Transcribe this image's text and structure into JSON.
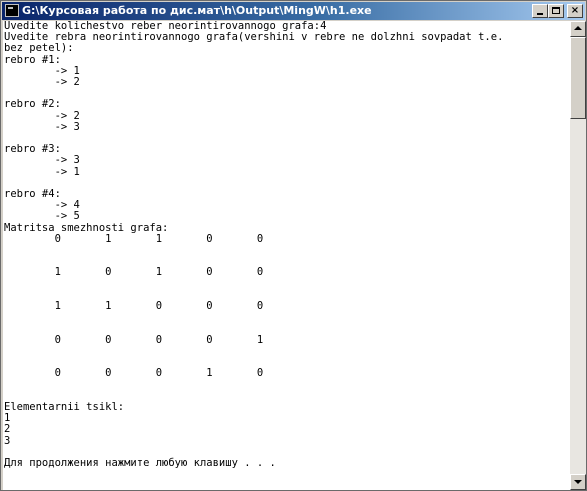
{
  "window": {
    "title": "G:\\Курсовая работа по дис.мат\\h\\Output\\MingW\\h1.exe",
    "minimize_label": "",
    "maximize_label": "",
    "close_label": "×"
  },
  "console": {
    "lines": [
      "Uvedite kolichestvo reber neorintirovannogo grafa:4",
      "Uvedite rebra neorintirovannogo grafa(vershini v rebre ne dolzhni sovpadat t.e.",
      "bez petel):",
      "rebro #1:",
      "        -> 1",
      "        -> 2",
      "",
      "rebro #2:",
      "        -> 2",
      "        -> 3",
      "",
      "rebro #3:",
      "        -> 3",
      "        -> 1",
      "",
      "rebro #4:",
      "        -> 4",
      "        -> 5",
      "Matritsa smezhnosti grafa:",
      "        0       1       1       0       0",
      "",
      "",
      "        1       0       1       0       0",
      "",
      "",
      "        1       1       0       0       0",
      "",
      "",
      "        0       0       0       0       1",
      "",
      "",
      "        0       0       0       1       0",
      "",
      "",
      "Elementarnii tsikl:",
      "1",
      "2",
      "3",
      "",
      "Для продолжения нажмите любую клавишу . . ."
    ]
  },
  "scrollbar": {
    "thumb_position": 0.0
  }
}
